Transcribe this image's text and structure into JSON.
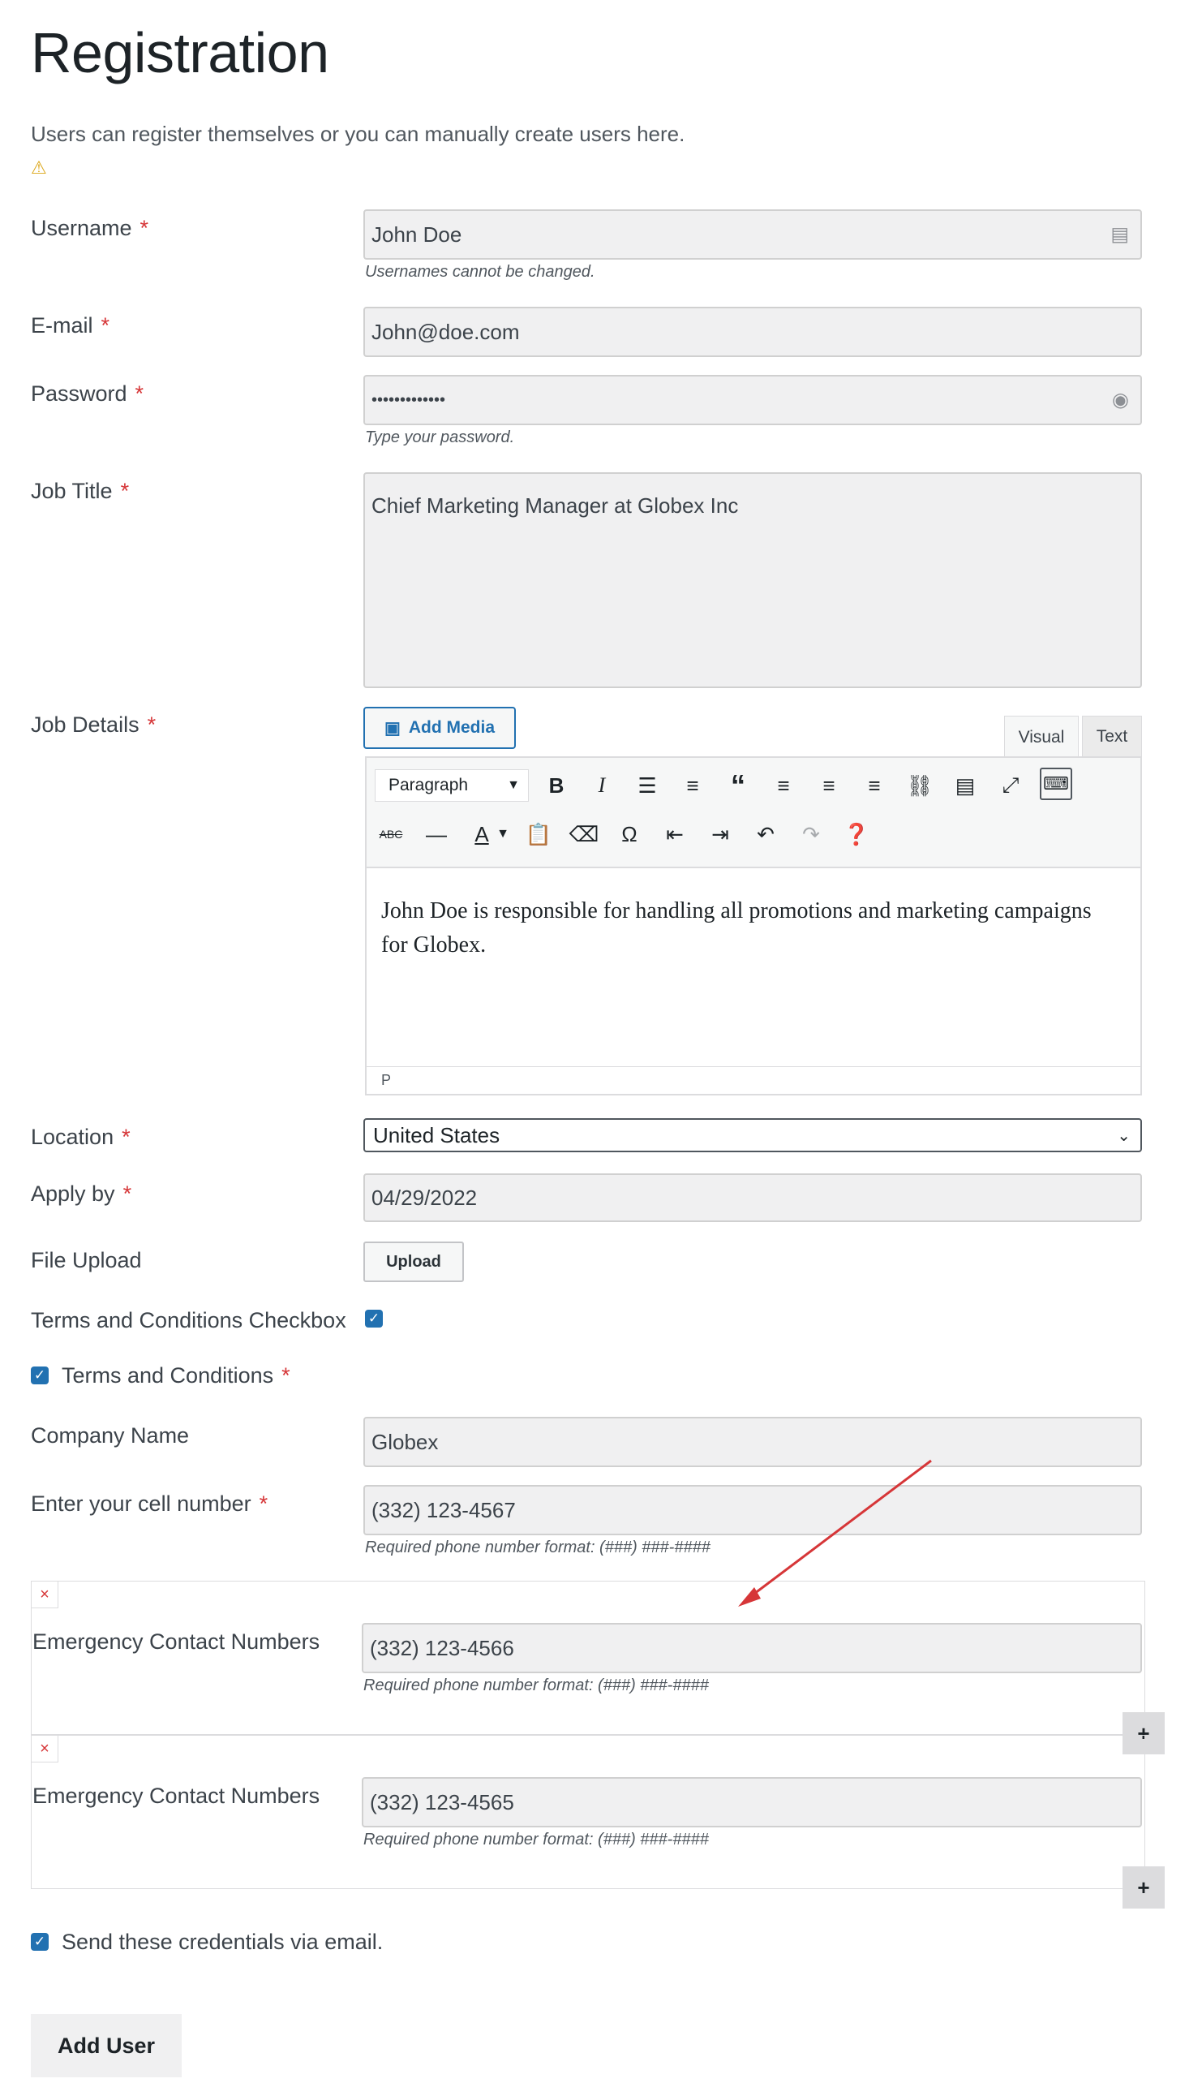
{
  "page": {
    "title": "Registration",
    "description": "Users can register themselves or you can manually create users here.",
    "warning_glyph": "⚠"
  },
  "required_marker": "*",
  "fields": {
    "username": {
      "label": "Username",
      "value": "John Doe",
      "hint": "Usernames cannot be changed."
    },
    "email": {
      "label": "E-mail",
      "value": "John@doe.com"
    },
    "password": {
      "label": "Password",
      "value": "•••••••••••••",
      "hint": "Type your password."
    },
    "job_title": {
      "label": "Job Title",
      "value": "Chief Marketing Manager at Globex Inc"
    },
    "job_details": {
      "label": "Job Details"
    },
    "location": {
      "label": "Location",
      "value": "United States"
    },
    "apply_by": {
      "label": "Apply by",
      "value": "04/29/2022"
    },
    "file_upload": {
      "label": "File Upload",
      "button": "Upload"
    },
    "terms_checkbox": {
      "label": "Terms and Conditions Checkbox",
      "checked": true
    },
    "terms": {
      "label": "Terms and Conditions",
      "checked": true
    },
    "company": {
      "label": "Company Name",
      "value": "Globex"
    },
    "cell": {
      "label": "Enter your cell number",
      "value": "(332) 123-4567",
      "hint": "Required phone number format: (###) ###-####"
    }
  },
  "editor": {
    "add_media": "Add Media",
    "tabs": [
      "Visual",
      "Text"
    ],
    "active_tab": "Visual",
    "paragraph_select": "Paragraph",
    "content": "John Doe is responsible for handling all promotions and marketing campaigns for Globex.",
    "status_path": "P",
    "toolbar_row1": [
      "bold-icon",
      "italic-icon",
      "bullet-list-icon",
      "numbered-list-icon",
      "blockquote-icon",
      "align-left-icon",
      "align-center-icon",
      "align-right-icon",
      "link-icon",
      "read-more-icon",
      "fullscreen-icon",
      "toolbar-toggle-icon"
    ],
    "toolbar_row2": [
      "strikethrough-icon",
      "horizontal-line-icon",
      "text-color-icon",
      "paste-text-icon",
      "clear-formatting-icon",
      "special-character-icon",
      "outdent-icon",
      "indent-icon",
      "undo-icon",
      "redo-icon",
      "help-icon"
    ]
  },
  "emergency": [
    {
      "label": "Emergency Contact Numbers",
      "value": "(332) 123-4566",
      "hint": "Required phone number format: (###) ###-####",
      "remove": "×",
      "add": "+"
    },
    {
      "label": "Emergency Contact Numbers",
      "value": "(332) 123-4565",
      "hint": "Required phone number format: (###) ###-####",
      "remove": "×",
      "add": "+"
    }
  ],
  "send_credentials": {
    "label": "Send these credentials via email.",
    "checked": true
  },
  "submit": {
    "label": "Add User"
  },
  "colors": {
    "accent": "#2271b1",
    "required": "#d63638",
    "annotation_arrow": "#d63638"
  }
}
